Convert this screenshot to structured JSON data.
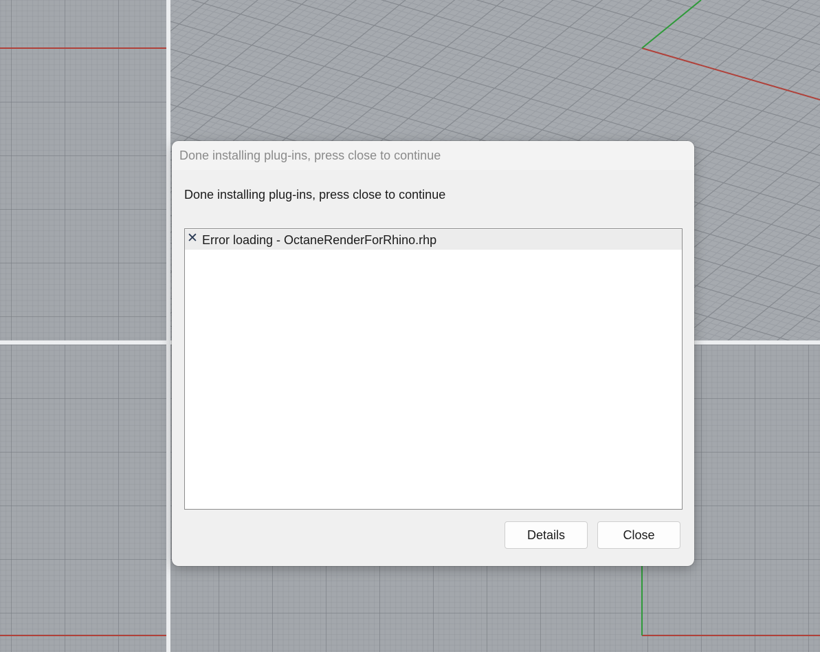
{
  "dialog": {
    "title": "Done installing plug-ins, press close to continue",
    "message": "Done installing plug-ins, press close to continue",
    "items": [
      {
        "icon": "close-x-icon",
        "status_glyph": "✕",
        "label": "Error loading - OctaneRenderForRhino.rhp"
      }
    ],
    "buttons": {
      "details": "Details",
      "close": "Close"
    }
  },
  "colors": {
    "viewport_bg": "#a4a8ad",
    "x_axis": "#b0413a",
    "y_axis": "#2f9a3a",
    "dialog_bg": "#f0f0f0"
  }
}
